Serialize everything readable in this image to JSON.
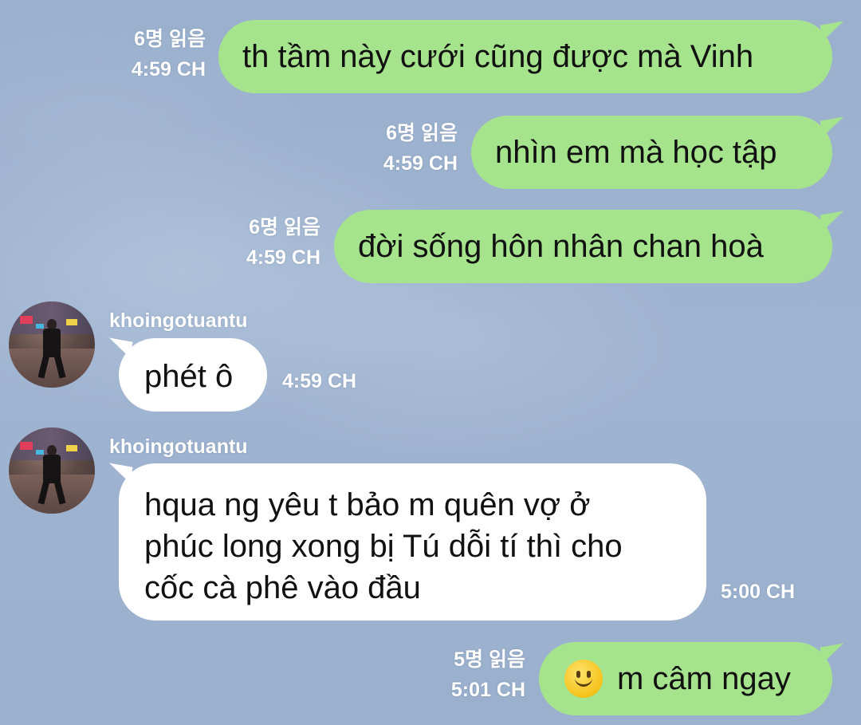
{
  "messages": [
    {
      "type": "out",
      "read": "6명 읽음",
      "time": "4:59 CH",
      "text": "th tầm này cưới cũng được mà Vinh"
    },
    {
      "type": "out",
      "read": "6명 읽음",
      "time": "4:59 CH",
      "text": "nhìn em mà học tập"
    },
    {
      "type": "out",
      "read": "6명 읽음",
      "time": "4:59 CH",
      "text": "đời sống hôn nhân chan hoà"
    },
    {
      "type": "in",
      "sender": "khoingotuantu",
      "time": "4:59 CH",
      "text": "phét ô"
    },
    {
      "type": "in",
      "sender": "khoingotuantu",
      "time": "5:00 CH",
      "lines": [
        "hqua ng yêu t bảo m quên vợ ở",
        "phúc long xong bị Tú dỗi tí thì cho",
        "cốc cà phê vào đầu"
      ]
    },
    {
      "type": "out",
      "read": "5명 읽음",
      "time": "5:01 CH",
      "emoji": "slightly-smiling-face-icon",
      "text": "m câm ngay"
    }
  ],
  "colors": {
    "outgoing_bubble": "#a6e38d",
    "incoming_bubble": "#ffffff",
    "background": "#9bb1cf",
    "meta_text": "#ffffff"
  }
}
